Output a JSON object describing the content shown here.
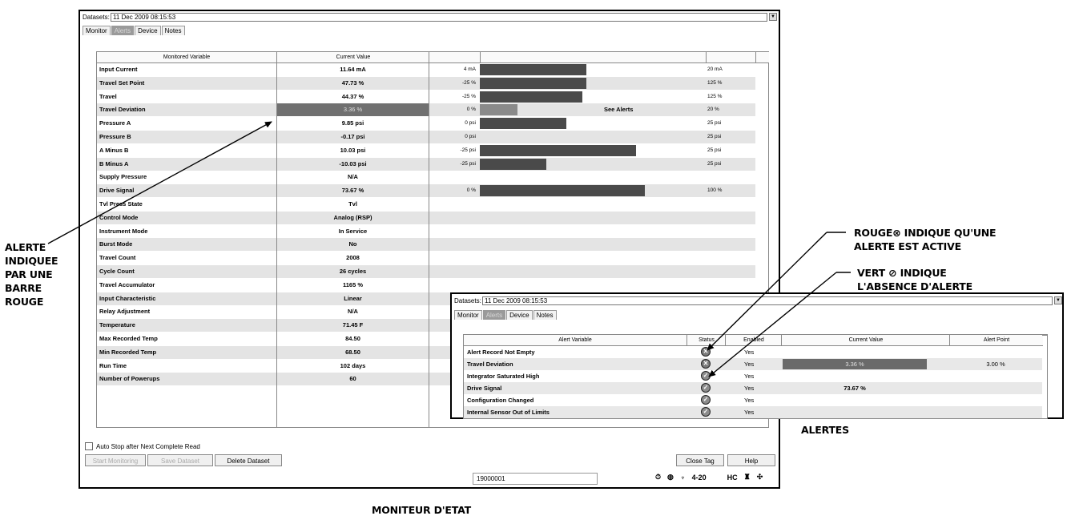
{
  "main_window": {
    "dataset_label": "Datasets:",
    "dataset_value": "11 Dec 2009 08:15:53",
    "tabs": [
      "Monitor",
      "Alerts",
      "Device",
      "Notes"
    ],
    "active_tab": "Alerts",
    "table_headers": {
      "variable": "Monitored Variable",
      "value": "Current Value"
    },
    "rows": [
      {
        "name": "Input Current",
        "value": "11.64 mA",
        "min": "4 mA",
        "max": "20 mA",
        "fill": 0.48
      },
      {
        "name": "Travel Set Point",
        "value": "47.73 %",
        "min": "-25 %",
        "max": "125 %",
        "fill": 0.48
      },
      {
        "name": "Travel",
        "value": "44.37 %",
        "min": "-25 %",
        "max": "125 %",
        "fill": 0.46
      },
      {
        "name": "Travel Deviation",
        "value": "3.36 %",
        "min": "0 %",
        "max": "20 %",
        "fill": 0.17,
        "alert": true,
        "note": "See Alerts"
      },
      {
        "name": "Pressure A",
        "value": "9.85 psi",
        "min": "0 psi",
        "max": "25 psi",
        "fill": 0.39
      },
      {
        "name": "Pressure B",
        "value": "-0.17 psi",
        "min": "0 psi",
        "max": "25 psi",
        "fill": 0
      },
      {
        "name": "A Minus B",
        "value": "10.03 psi",
        "min": "-25 psi",
        "max": "25 psi",
        "fill": 0.7
      },
      {
        "name": "B Minus A",
        "value": "-10.03 psi",
        "min": "-25 psi",
        "max": "25 psi",
        "fill": 0.3
      },
      {
        "name": "Supply Pressure",
        "value": "N/A",
        "min": "",
        "max": "",
        "fill": null
      },
      {
        "name": "Drive Signal",
        "value": "73.67 %",
        "min": "0 %",
        "max": "100 %",
        "fill": 0.74
      },
      {
        "name": "Tvl Press State",
        "value": "Tvl",
        "min": "",
        "max": "",
        "fill": null
      },
      {
        "name": "Control Mode",
        "value": "Analog (RSP)",
        "min": "",
        "max": "",
        "fill": null
      },
      {
        "name": "Instrument Mode",
        "value": "In Service",
        "min": "",
        "max": "",
        "fill": null
      },
      {
        "name": "Burst Mode",
        "value": "No",
        "min": "",
        "max": "",
        "fill": null
      },
      {
        "name": "Travel Count",
        "value": "2008",
        "min": "",
        "max": "",
        "fill": null
      },
      {
        "name": "Cycle Count",
        "value": "26 cycles",
        "min": "",
        "max": "",
        "fill": null
      },
      {
        "name": "Travel Accumulator",
        "value": "1165 %",
        "min": "",
        "max": "",
        "fill": null
      },
      {
        "name": "Input Characteristic",
        "value": "Linear",
        "min": "",
        "max": "",
        "fill": null
      },
      {
        "name": "Relay Adjustment",
        "value": "N/A",
        "min": "",
        "max": "",
        "fill": null
      },
      {
        "name": "Temperature",
        "value": "71.45 F",
        "min": "",
        "max": "",
        "fill": null
      },
      {
        "name": "Max Recorded Temp",
        "value": "84.50",
        "min": "",
        "max": "",
        "fill": null
      },
      {
        "name": "Min Recorded Temp",
        "value": "68.50",
        "min": "",
        "max": "",
        "fill": null
      },
      {
        "name": "Run Time",
        "value": "102 days",
        "min": "",
        "max": "",
        "fill": null
      },
      {
        "name": "Number of Powerups",
        "value": "60",
        "min": "",
        "max": "",
        "fill": null
      }
    ],
    "auto_stop_label": "Auto Stop after Next Complete Read",
    "buttons": {
      "start": "Start Monitoring",
      "save": "Save Dataset",
      "delete": "Delete Dataset",
      "close_tag": "Close Tag",
      "help": "Help"
    },
    "status_tag": "19000001",
    "status_icons": {
      "loop": "4-20",
      "protocol": "HC"
    }
  },
  "inset_window": {
    "dataset_label": "Datasets:",
    "dataset_value": "11 Dec 2009 08:15:53",
    "tabs": [
      "Monitor",
      "Alerts",
      "Device",
      "Notes"
    ],
    "active_tab": "Alerts",
    "headers": {
      "variable": "Alert Variable",
      "status": "Status",
      "enabled": "Enabled",
      "current": "Current Value",
      "point": "Alert Point"
    },
    "rows": [
      {
        "name": "Alert Record Not Empty",
        "status": "alert",
        "enabled": "Yes",
        "current": "",
        "point": ""
      },
      {
        "name": "Travel Deviation",
        "status": "alert",
        "enabled": "Yes",
        "current": "3.36 %",
        "point": "3.00 %",
        "highlight": true
      },
      {
        "name": "Integrator Saturated High",
        "status": "ok",
        "enabled": "Yes",
        "current": "",
        "point": ""
      },
      {
        "name": "Drive Signal",
        "status": "ok",
        "enabled": "Yes",
        "current": "73.67 %",
        "point": ""
      },
      {
        "name": "Configuration Changed",
        "status": "ok",
        "enabled": "Yes",
        "current": "",
        "point": ""
      },
      {
        "name": "Internal Sensor Out of Limits",
        "status": "ok",
        "enabled": "Yes",
        "current": "",
        "point": ""
      }
    ]
  },
  "captions": {
    "left": [
      "ALERTE",
      "INDIQUEE",
      "PAR UNE",
      "BARRE",
      "ROUGE"
    ],
    "red_a": "ROUGE",
    "red_b": " INDIQUE QU'UNE",
    "red_line2": "ALERTE EST ACTIVE",
    "green_a": "VERT ",
    "green_b": " INDIQUE",
    "green_line2": "L'ABSENCE D'ALERTE",
    "alertes": "ALERTES",
    "bottom": "MONITEUR D'ETAT"
  },
  "colors": {
    "bar": "#4a4a4a",
    "alert_fill": "#707070",
    "shade": "#e4e4e4"
  }
}
